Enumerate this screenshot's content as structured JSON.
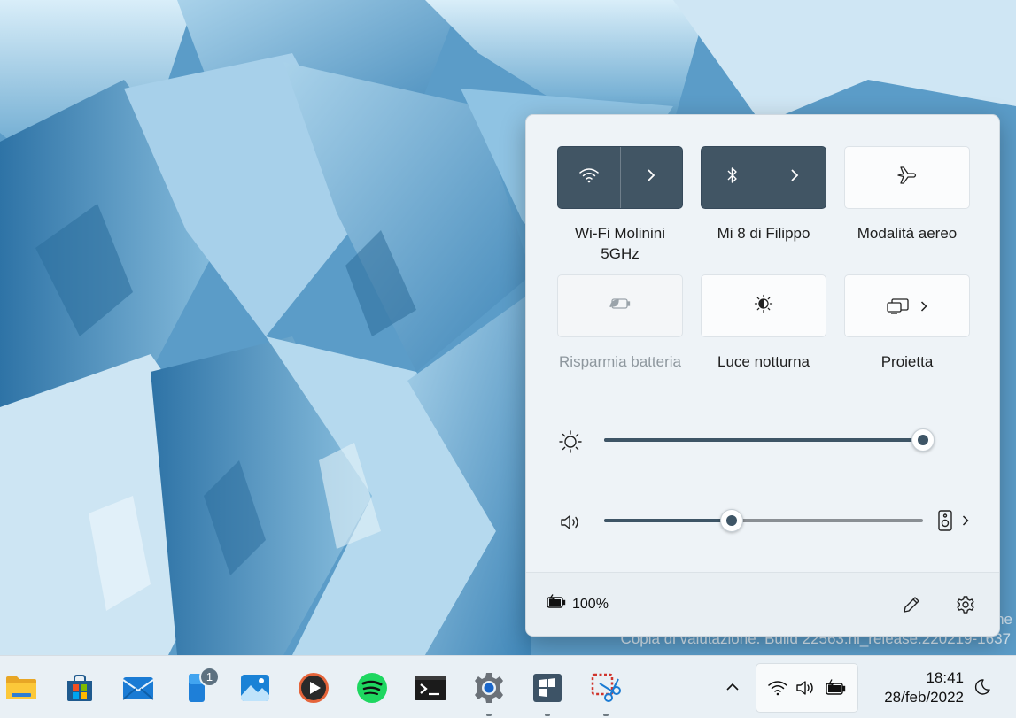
{
  "quick_settings": {
    "tiles": [
      {
        "label": "Wi-Fi Molinini 5GHz",
        "state": "on",
        "icon": "wifi-icon",
        "has_chevron": true
      },
      {
        "label": "Mi 8 di Filippo",
        "state": "on",
        "icon": "bluetooth-icon",
        "has_chevron": true
      },
      {
        "label": "Modalità aereo",
        "state": "off",
        "icon": "airplane-icon"
      },
      {
        "label": "Risparmia batteria",
        "state": "disabled",
        "icon": "battery-saver-icon"
      },
      {
        "label": "Luce notturna",
        "state": "off",
        "icon": "night-light-icon"
      },
      {
        "label": "Proietta",
        "state": "off",
        "icon": "project-icon",
        "has_chevron": true
      }
    ],
    "brightness": {
      "icon": "brightness-icon",
      "value_percent": 100
    },
    "volume": {
      "icon": "speaker-icon",
      "value_percent": 40,
      "output_icon": "audio-device-icon"
    },
    "battery": {
      "icon": "battery-charging-icon",
      "text": "100%"
    },
    "footer_icons": [
      "edit-pencil-icon",
      "settings-gear-icon"
    ]
  },
  "desktop": {
    "watermark": "Copia di valutazione. Build 22563.ni_release.220219-1637",
    "watermark_edge": "ne"
  },
  "taskbar": {
    "apps": [
      {
        "name": "File Explorer",
        "icon": "folder-icon"
      },
      {
        "name": "Microsoft Store",
        "icon": "store-icon"
      },
      {
        "name": "Mail",
        "icon": "mail-icon"
      },
      {
        "name": "Phone",
        "icon": "phone-icon",
        "badge": "1"
      },
      {
        "name": "Photos",
        "icon": "photos-icon"
      },
      {
        "name": "Media player",
        "icon": "media-player-icon"
      },
      {
        "name": "Spotify",
        "icon": "spotify-icon"
      },
      {
        "name": "Terminal",
        "icon": "terminal-icon"
      },
      {
        "name": "Settings",
        "icon": "settings-icon",
        "running": true
      },
      {
        "name": "Remote desktop",
        "icon": "remote-desktop-icon",
        "running": true
      },
      {
        "name": "Snipping tool",
        "icon": "snipping-tool-icon",
        "running": true
      }
    ],
    "tray": {
      "overflow_icon": "chevron-up-icon",
      "icons": [
        "wifi-icon",
        "speaker-icon",
        "battery-charging-icon"
      ],
      "time": "18:41",
      "date": "28/feb/2022",
      "focus_icon": "moon-icon"
    },
    "colors": {
      "accent": "#415564",
      "taskbar": "#e9f0f5"
    }
  }
}
